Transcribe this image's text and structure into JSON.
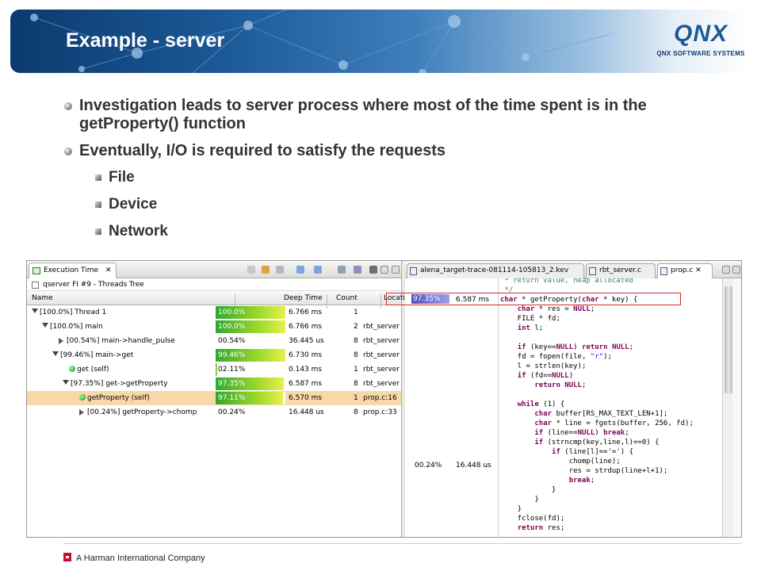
{
  "slide": {
    "title": "Example - server",
    "logo": {
      "word": "QNX",
      "sub": "QNX SOFTWARE SYSTEMS"
    },
    "bullets": [
      {
        "text": "Investigation leads to server process where most of the time spent is in the getProperty() function"
      },
      {
        "text": "Eventually, I/O is required to satisfy the requests"
      }
    ],
    "sub_bullets": [
      "File",
      "Device",
      "Network"
    ],
    "footer": "A Harman International Company"
  },
  "left_panel": {
    "tab_label": "Execution Time",
    "tab_close": "✕",
    "breadcrumb": "qserver FI #9 - Threads Tree",
    "columns": {
      "name": "Name",
      "deep_time": "Deep Time",
      "count": "Count",
      "location": "Location"
    },
    "rows": [
      {
        "name": "[100.0%] Thread 1",
        "pct": "100.0%",
        "fill": 1.0,
        "time": "6.766 ms",
        "count": "1",
        "loc": ""
      },
      {
        "name": "[100.0%] main",
        "pct": "100.0%",
        "fill": 1.0,
        "time": "6.766 ms",
        "count": "2",
        "loc": "rbt_server"
      },
      {
        "name": "[00.54%] main->handle_pulse",
        "pct": "00.54%",
        "fill": 0.0054,
        "time": "36.445 us",
        "count": "8",
        "loc": "rbt_server"
      },
      {
        "name": "[99.46%] main->get",
        "pct": "99.46%",
        "fill": 0.9946,
        "time": "6.730 ms",
        "count": "8",
        "loc": "rbt_server"
      },
      {
        "name": "get (self)",
        "pct": "02.11%",
        "fill": 0.0211,
        "time": "0.143 ms",
        "count": "1",
        "loc": "rbt_server"
      },
      {
        "name": "[97.35%] get->getProperty",
        "pct": "97.35%",
        "fill": 0.9735,
        "time": "6.587 ms",
        "count": "8",
        "loc": "rbt_server"
      },
      {
        "name": "getProperty (self)",
        "pct": "97.11%",
        "fill": 0.9711,
        "time": "6.570 ms",
        "count": "1",
        "loc": "prop.c:16"
      },
      {
        "name": "[00.24%] getProperty->chomp",
        "pct": "00.24%",
        "fill": 0.0024,
        "time": "16.448 us",
        "count": "8",
        "loc": "prop.c:33"
      }
    ]
  },
  "right_panel": {
    "tabs": [
      {
        "label": "alena_target-trace-081114-105813_2.kev"
      },
      {
        "label": "rbt_server.c"
      },
      {
        "label": "prop.c ✕"
      }
    ],
    "gutter": [
      {
        "pct": "97.35%",
        "time": "6.587 ms"
      },
      {
        "pct": "00.24%",
        "time": "16.448 us"
      }
    ],
    "code_lines": [
      " * return value, heap allocated",
      " */",
      "char * getProperty(char * key) {",
      "    char * res = NULL;",
      "    FILE * fd;",
      "    int l;",
      "",
      "    if (key==NULL) return NULL;",
      "    fd = fopen(file, \"r\");",
      "    l = strlen(key);",
      "    if (fd==NULL)",
      "        return NULL;",
      "",
      "    while (1) {",
      "        char buffer[RS_MAX_TEXT_LEN+1];",
      "        char * line = fgets(buffer, 256, fd);",
      "        if (line==NULL) break;",
      "        if (strncmp(key,line,l)==0) {",
      "            if (line[l]=='=') {",
      "                chomp(line);",
      "                res = strdup(line+l+1);",
      "                break;",
      "            }",
      "        }",
      "    }",
      "    fclose(fd);",
      "    return res;"
    ]
  }
}
